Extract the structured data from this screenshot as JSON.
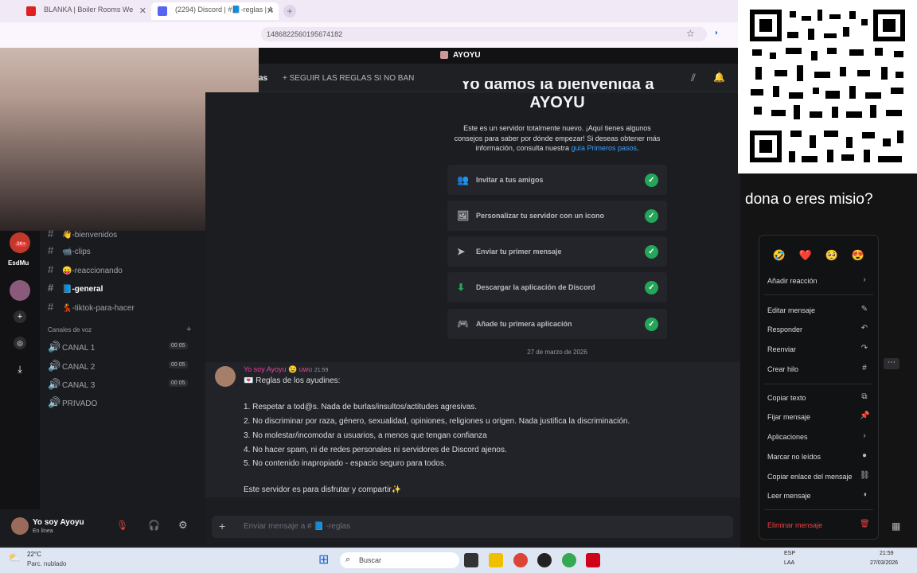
{
  "browser": {
    "tab1": "BLANKA | Boiler Rooms We",
    "tab2": "(2294) Discord | #📘-reglas | A",
    "url": "1486822560195674182"
  },
  "server_title": "AYOYU",
  "channel_header": {
    "partial": "as",
    "topic": "+ SEGUIR LAS REGLAS SI NO BAN"
  },
  "welcome": {
    "title_line1": "Yo damos la bienvenida a",
    "title_line2": "AYOYU",
    "desc": "Este es un servidor totalmente nuevo. ¡Aquí tienes algunos consejos para saber por dónde empezar! Si deseas obtener más información, consulta nuestra ",
    "link": "guía Primeros pasos",
    "desc_end": "."
  },
  "checklist": [
    {
      "label": "Invitar a tus amigos",
      "icon": "👥"
    },
    {
      "label": "Personalizar tu servidor con un icono",
      "icon": "🖼"
    },
    {
      "label": "Enviar tu primer mensaje",
      "icon": "➤"
    },
    {
      "label": "Descargar la aplicación de Discord",
      "icon": "⬇"
    },
    {
      "label": "Añade tu primera aplicación",
      "icon": "🎮"
    }
  ],
  "date_divider": "27 de marzo de 2026",
  "message": {
    "author": "Yo soy Ayoyu",
    "tag": "uwu",
    "time": "21:59",
    "lines": [
      "💌 Reglas de los ayudines:",
      "1. Respetar a tod@s. Nada de burlas/insultos/actitudes agresivas.",
      "2. No discriminar por raza, género, sexualidad, opiniones, religiones u origen. Nada justifica la discriminación.",
      "3. No molestar/incomodar a usuarios, a menos que tengan confianza",
      "4. No hacer spam, ni de redes personales ni servidores de Discord ajenos.",
      "5. No contenido inapropiado - espacio seguro para todos.",
      "Este servidor es para disfrutar y compartir✨"
    ]
  },
  "sidebar": {
    "channels": [
      {
        "name": "👋-bienvenidos"
      },
      {
        "name": "📹-clips"
      },
      {
        "name": "😛-reaccionando"
      },
      {
        "name": "📘-general"
      },
      {
        "name": "💃-tiktok-para-hacer"
      }
    ],
    "voice_header": "Canales de voz",
    "voice": [
      {
        "name": "CANAL 1",
        "a": "00",
        "b": "05"
      },
      {
        "name": "CANAL 2",
        "a": "00",
        "b": "05"
      },
      {
        "name": "CANAL 3",
        "a": "00",
        "b": "05"
      },
      {
        "name": "PRIVADO"
      }
    ],
    "server_label": "EsdMu",
    "badge": "2K+"
  },
  "user": {
    "name": "Yo soy Ayoyu",
    "status": "En línea"
  },
  "composer": {
    "placeholder": "Enviar mensaje a # 📘 -reglas"
  },
  "overlay": {
    "dona": "dona o eres misio?"
  },
  "context_menu": {
    "reactions": [
      "🤣",
      "❤️",
      "🥺",
      "😍"
    ],
    "items": [
      {
        "label": "Añadir reacción",
        "icon": "›"
      },
      {
        "label": "Editar mensaje",
        "icon": "✎"
      },
      {
        "label": "Responder",
        "icon": "↶"
      },
      {
        "label": "Reenviar",
        "icon": "↷"
      },
      {
        "label": "Crear hilo",
        "icon": "#"
      },
      {
        "label": "Copiar texto",
        "icon": "⧉"
      },
      {
        "label": "Fijar mensaje",
        "icon": "📌"
      },
      {
        "label": "Aplicaciones",
        "icon": "›"
      },
      {
        "label": "Marcar no leídos",
        "icon": "●"
      },
      {
        "label": "Copiar enlace del mensaje",
        "icon": "⛓"
      },
      {
        "label": "Leer mensaje",
        "icon": "◑"
      },
      {
        "label": "Eliminar mensaje",
        "icon": "🗑"
      }
    ]
  },
  "taskbar": {
    "temp": "22°C",
    "weather": "Parc. nublado",
    "search": "Buscar",
    "lang1": "ESP",
    "lang2": "LAA",
    "time": "21:59",
    "date": "27/03/2026"
  }
}
